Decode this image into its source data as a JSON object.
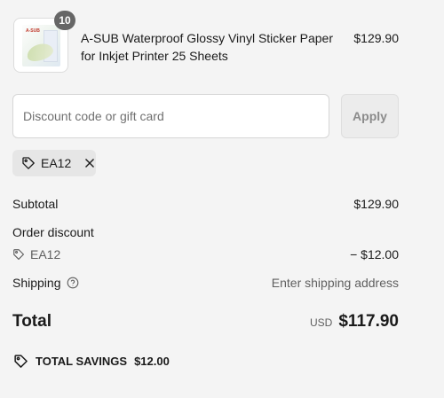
{
  "product": {
    "quantity": "10",
    "title": "A-SUB Waterproof Glossy Vinyl Sticker Paper for Inkjet Printer 25 Sheets",
    "price": "$129.90",
    "thumb_logo": "A-SUB"
  },
  "discount": {
    "placeholder": "Discount code or gift card",
    "value": "",
    "apply_label": "Apply",
    "applied_code": "EA12"
  },
  "summary": {
    "subtotal_label": "Subtotal",
    "subtotal_value": "$129.90",
    "order_discount_label": "Order discount",
    "discount_code": "EA12",
    "discount_value": "− $12.00",
    "shipping_label": "Shipping",
    "shipping_value": "Enter shipping address",
    "total_label": "Total",
    "currency": "USD",
    "total_value": "$117.90",
    "savings_label": "TOTAL SAVINGS",
    "savings_value": "$12.00"
  },
  "icons": {
    "tag": "tag-icon",
    "close": "close-icon",
    "help": "question-circle-icon"
  }
}
